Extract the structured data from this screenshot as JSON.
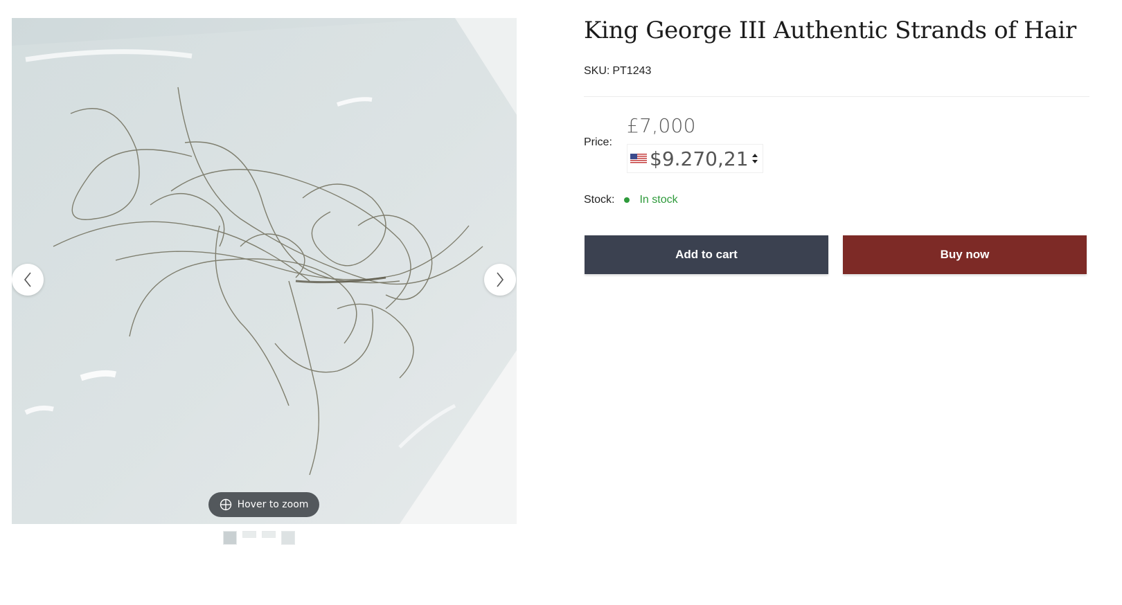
{
  "product": {
    "title": "King George III Authentic Strands of Hair",
    "sku_label": "SKU:",
    "sku_value": "PT1243"
  },
  "price": {
    "label": "Price:",
    "gbp": "£7,000",
    "usd": "$9.270,21",
    "currency_flag": "us-flag-icon"
  },
  "stock": {
    "label": "Stock:",
    "value": "In stock",
    "status_color": "#2e9a3b"
  },
  "actions": {
    "add_to_cart": "Add to cart",
    "buy_now": "Buy now",
    "add_to_cart_color": "#3b4150",
    "buy_now_color": "#7d2a26"
  },
  "gallery": {
    "zoom_hint": "Hover to zoom",
    "thumbnail_count": 4,
    "active_thumbnail": 1
  }
}
